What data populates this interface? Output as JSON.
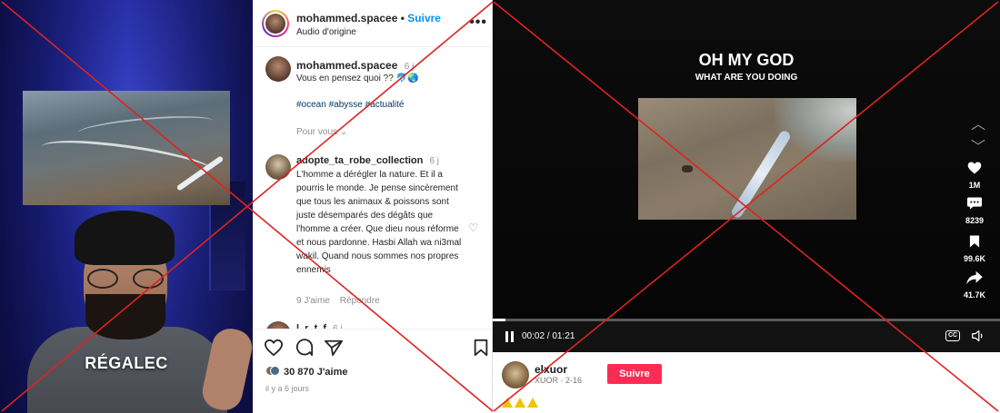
{
  "left_video": {
    "overlay_caption": "RÉGALEC"
  },
  "instagram": {
    "header": {
      "username": "mohammed.spacee",
      "separator": "•",
      "follow_label": "Suivre",
      "audio_label": "Audio d'origine",
      "more_icon": "more-horizontal-icon"
    },
    "post": {
      "username": "mohammed.spacee",
      "time": "6 j",
      "text": "Vous en pensez quoi ?? 🐬🌏",
      "hashtags": "#ocean #abysse #actualité",
      "pour_vous": "Pour vous"
    },
    "comments": [
      {
        "username": "adopte_ta_robe_collection",
        "time": "6 j",
        "text": "L'homme a dérégler la nature. Et il a pourris le monde. Je pense sincèrement que tous les animaux & poissons sont juste désemparés des dégâts que l'homme a créer. Que dieu nous réforme et nous pardonne. Hasbi Allah wa ni3mal wakil. Quand nous sommes nos propres ennemis",
        "likes": "9 J'aime",
        "reply_label": "Répondre"
      }
    ],
    "partial_comment_username": "l_r_t_f",
    "partial_comment_time": "6 j",
    "likes_count": "30 870 J'aime",
    "posted_ago": "il y a 6 jours",
    "action_icons": [
      "heart-icon",
      "comment-icon",
      "share-icon",
      "bookmark-icon"
    ]
  },
  "tiktok": {
    "title": "OH MY GOD",
    "subtitle": "WHAT ARE YOU DOING",
    "side": {
      "likes": "1M",
      "comments": "8239",
      "saves": "99.6K",
      "shares": "41.7K"
    },
    "time": "00:02 / 01:21",
    "progress": 0.025,
    "cc_label": "CC",
    "author": {
      "username": "elxuor",
      "handle": "XUOR · 2-16"
    },
    "follow_label": "Suivre",
    "caption_emoji": "⚠️⚠️⚠️"
  },
  "colors": {
    "cross_red": "#e0221e",
    "ig_blue": "#0095f6",
    "tiktok_red": "#fe2c55",
    "warning_yellow": "#f2c200"
  }
}
